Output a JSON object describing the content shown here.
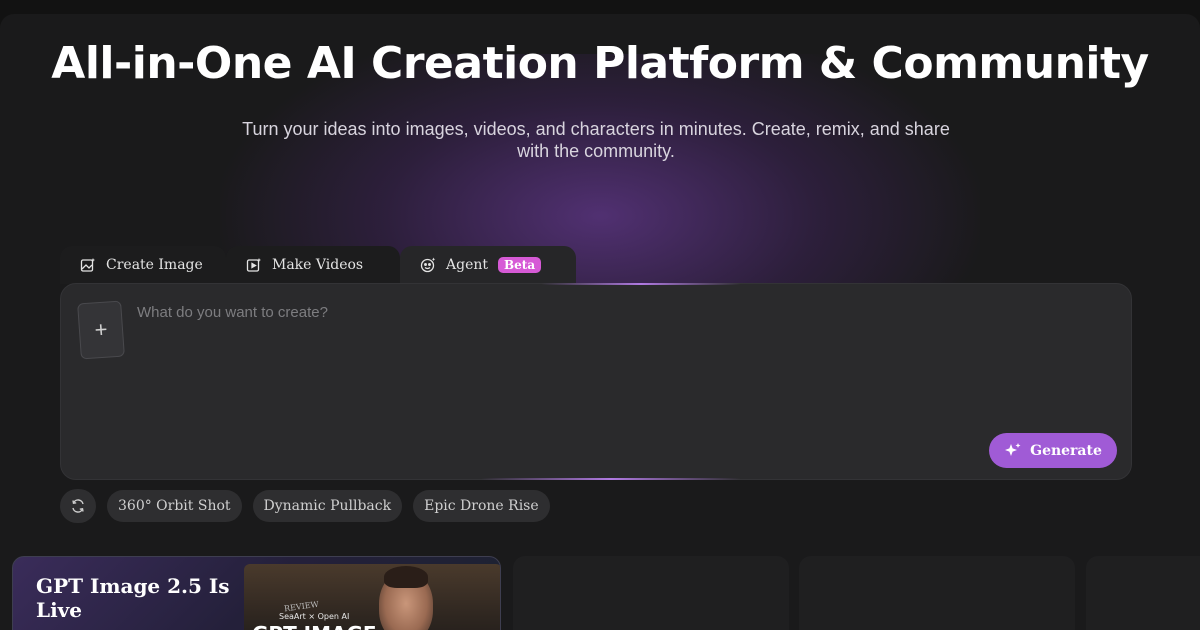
{
  "hero": {
    "title": "All-in-One AI Creation Platform & Community",
    "subtitle": "Turn your ideas into images, videos, and characters in minutes. Create, remix, and share with the community."
  },
  "tabs": [
    {
      "label": "Create Image",
      "icon": "image-sparkle-icon"
    },
    {
      "label": "Make Videos",
      "icon": "video-sparkle-icon"
    },
    {
      "label": "Agent",
      "icon": "agent-face-icon",
      "badge": "Beta"
    }
  ],
  "prompt": {
    "placeholder": "What do you want to create?",
    "value": "",
    "upload_icon": "+",
    "generate_label": "Generate"
  },
  "chips": [
    "360° Orbit Shot",
    "Dynamic Pullback",
    "Epic Drone Rise"
  ],
  "promo": {
    "title": "GPT Image 2.5 Is Live",
    "image_brand": "SeaArt × Open AI",
    "image_heading": "GPT IMAGE",
    "image_tag": "REVIEW"
  },
  "colors": {
    "accent": "#a05bd6",
    "badge": "#d65ad6",
    "background": "#1a1a1b"
  }
}
